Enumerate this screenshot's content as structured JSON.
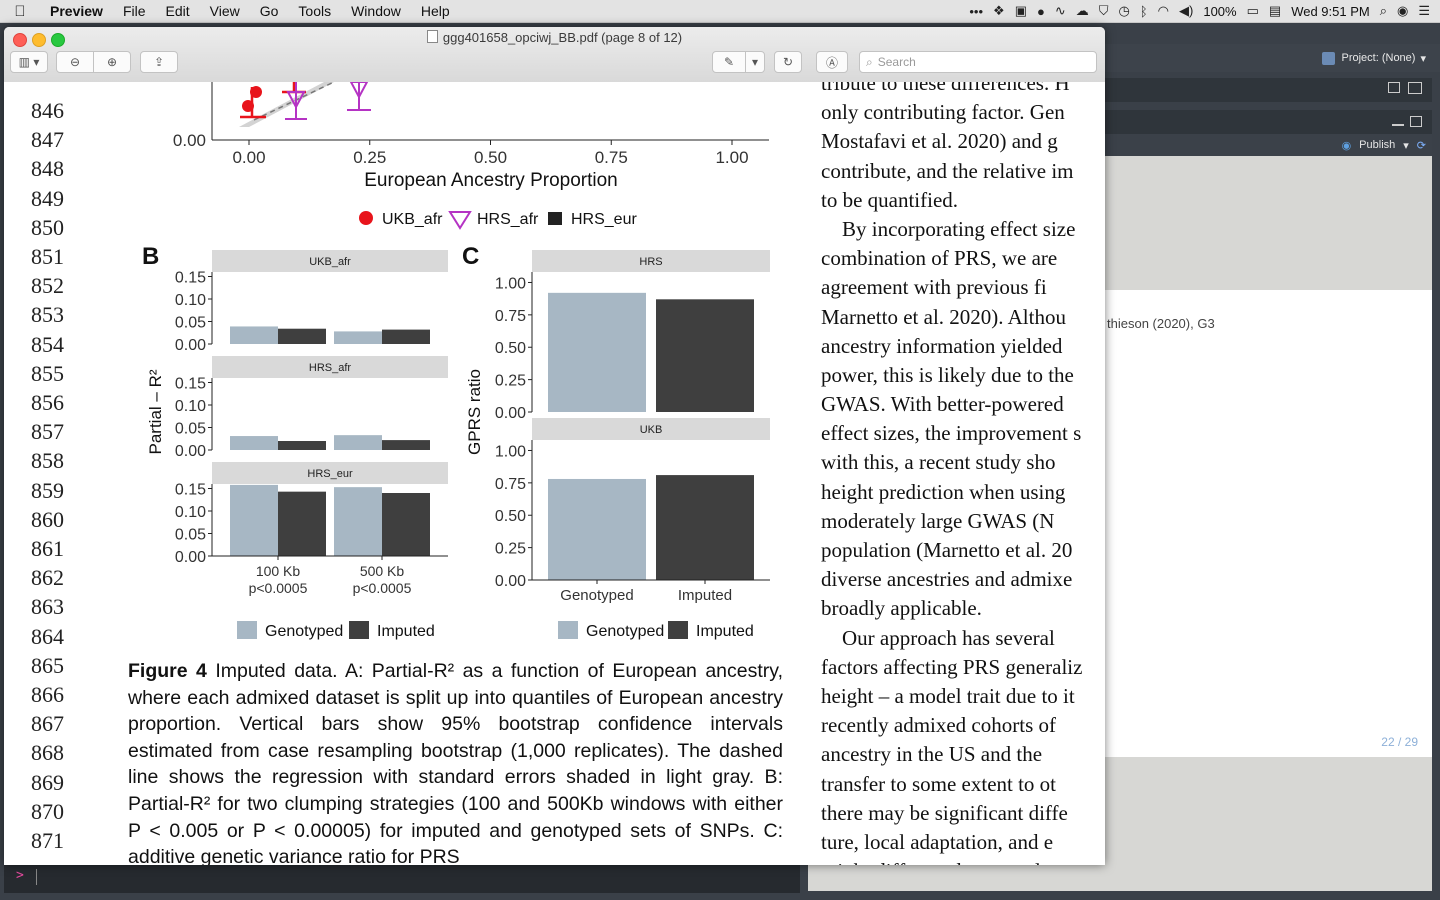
{
  "menubar": {
    "app": "Preview",
    "menus": [
      "File",
      "Edit",
      "View",
      "Go",
      "Tools",
      "Window",
      "Help"
    ],
    "battery": "100%",
    "clock": "Wed 9:51 PM"
  },
  "window": {
    "title": "ggg401658_opciwj_BB.pdf (page 8 of 12)",
    "search_placeholder": "Search"
  },
  "rstudio": {
    "project": "Project: (None)",
    "publish": "Publish",
    "citation": "thieson (2020), G3",
    "slide_counter": "22 / 29",
    "console_prompt": ">"
  },
  "document": {
    "line_numbers": [
      "846",
      "847",
      "848",
      "849",
      "850",
      "851",
      "852",
      "853",
      "854",
      "855",
      "856",
      "857",
      "858",
      "859",
      "860",
      "861",
      "862",
      "863",
      "864",
      "865",
      "866",
      "867",
      "868",
      "869",
      "870",
      "871"
    ],
    "right_column": [
      "tribute to these differences. H",
      "only contributing factor. Gen",
      "Mostafavi et al. 2020) and g",
      "contribute, and the relative im",
      "to be quantified.",
      "    By incorporating effect size",
      "combination of PRS, we are",
      "agreement with previous fi",
      "Marnetto et al. 2020). Althou",
      "ancestry information yielded",
      "power, this is likely due to the",
      "GWAS. With better-powered",
      "effect sizes, the improvement s",
      "with this, a recent study sho",
      "height prediction when using",
      "moderately large GWAS (N",
      "population (Marnetto et al. 20",
      "diverse ancestries and admixe",
      "broadly applicable.",
      "    Our approach has several",
      "factors affecting PRS generaliz",
      "height – a model trait due to it",
      "recently admixed cohorts of",
      "ancestry in the US and the",
      "transfer to some extent to ot",
      "there may be significant diffe",
      "ture, local adaptation, and e",
      "might differ, and our results"
    ],
    "caption_head": "Figure 4",
    "caption_body": "Imputed data. A: Partial-R² as a function of European ancestry, where each admixed dataset is split up into quantiles of European ancestry proportion. Vertical bars show 95% bootstrap confidence intervals estimated from case resampling bootstrap (1,000 replicates). The dashed line shows the regression with standard errors shaded in light gray. B: Partial-R² for two clumping strategies (100 and 500Kb windows with either P < 0.005 or P < 0.00005) for imputed and genotyped sets of SNPs. C: additive genetic variance ratio for PRS"
  },
  "chart_data": [
    {
      "type": "scatter",
      "panel": "A",
      "xlabel": "European Ancestry Proportion",
      "xticks": [
        "0.00",
        "0.25",
        "0.50",
        "0.75",
        "1.00"
      ],
      "xlim": [
        0,
        1
      ],
      "ytick_visible": "0.00",
      "legend": [
        "UKB_afr",
        "HRS_afr",
        "HRS_eur"
      ],
      "colors": {
        "UKB_afr": "#e8141b",
        "HRS_afr": "#b533c4",
        "HRS_eur": "#222222"
      }
    },
    {
      "type": "bar",
      "panel": "B",
      "ylabel": "Partial – R²",
      "yticks": [
        "0.00",
        "0.05",
        "0.10",
        "0.15"
      ],
      "ylim": [
        0,
        0.16
      ],
      "categories": [
        "100 Kb\np<0.0005",
        "500 Kb\np<0.0005"
      ],
      "facets": [
        {
          "name": "UKB_afr",
          "series": [
            {
              "name": "Genotyped",
              "values": [
                0.039,
                0.028
              ]
            },
            {
              "name": "Imputed",
              "values": [
                0.034,
                0.032
              ]
            }
          ]
        },
        {
          "name": "HRS_afr",
          "series": [
            {
              "name": "Genotyped",
              "values": [
                0.031,
                0.033
              ]
            },
            {
              "name": "Imputed",
              "values": [
                0.02,
                0.022
              ]
            }
          ]
        },
        {
          "name": "HRS_eur",
          "series": [
            {
              "name": "Genotyped",
              "values": [
                0.158,
                0.153
              ]
            },
            {
              "name": "Imputed",
              "values": [
                0.143,
                0.14
              ]
            }
          ]
        }
      ],
      "legend": [
        "Genotyped",
        "Imputed"
      ],
      "colors": {
        "Genotyped": "#a7b7c4",
        "Imputed": "#3f3f3f"
      }
    },
    {
      "type": "bar",
      "panel": "C",
      "ylabel": "GPRS ratio",
      "yticks": [
        "0.00",
        "0.25",
        "0.50",
        "0.75",
        "1.00"
      ],
      "ylim": [
        0,
        1.05
      ],
      "categories": [
        "Genotyped",
        "Imputed"
      ],
      "facets": [
        {
          "name": "HRS",
          "values": [
            0.92,
            0.87
          ]
        },
        {
          "name": "UKB",
          "values": [
            0.78,
            0.81
          ]
        }
      ],
      "legend": [
        "Genotyped",
        "Imputed"
      ]
    }
  ]
}
